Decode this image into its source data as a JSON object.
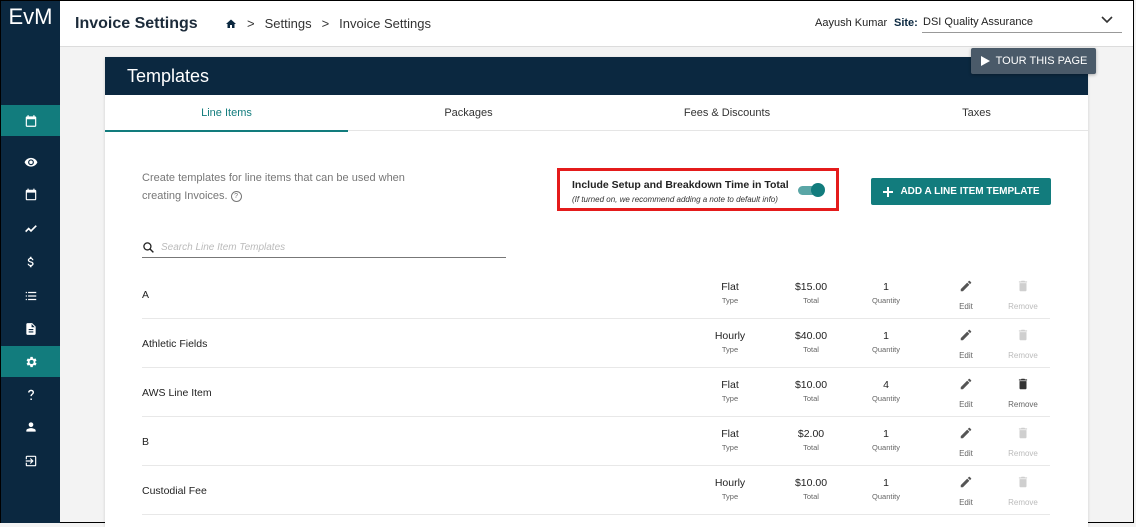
{
  "app": {
    "logo": "EvM"
  },
  "header": {
    "page_title": "Invoice Settings",
    "breadcrumb": [
      "Settings",
      "Invoice Settings"
    ],
    "breadcrumb_sep": ">",
    "user_name": "Aayush Kumar",
    "site_label": "Site:",
    "site_value": "DSI Quality Assurance"
  },
  "sidebar": {
    "items": [
      {
        "icon": "calendar-today-icon",
        "active": true
      },
      {
        "icon": "eye-icon",
        "active": false
      },
      {
        "icon": "calendar-icon",
        "active": false
      },
      {
        "icon": "trending-icon",
        "active": false
      },
      {
        "icon": "dollar-icon",
        "active": false
      },
      {
        "icon": "list-icon",
        "active": false
      },
      {
        "icon": "document-icon",
        "active": false
      },
      {
        "icon": "gear-icon",
        "active": true
      },
      {
        "icon": "help-icon",
        "active": false
      },
      {
        "icon": "user-icon",
        "active": false
      },
      {
        "icon": "logout-icon",
        "active": false
      }
    ]
  },
  "tour_button": "TOUR THIS PAGE",
  "card": {
    "title": "Templates",
    "tabs": [
      "Line Items",
      "Packages",
      "Fees & Discounts",
      "Taxes"
    ],
    "active_tab": 0,
    "description": "Create templates for line items that can be used when creating Invoices.",
    "toggle": {
      "title": "Include Setup and Breakdown Time in Total",
      "subtitle": "(If turned on, we recommend adding a note to default info)",
      "on": true
    },
    "add_button": "ADD A LINE ITEM TEMPLATE",
    "search_placeholder": "Search Line Item Templates",
    "columns": {
      "type": "Type",
      "total": "Total",
      "quantity": "Quantity",
      "edit": "Edit",
      "remove": "Remove"
    },
    "rows": [
      {
        "name": "A",
        "type": "Flat",
        "total": "$15.00",
        "quantity": "1",
        "removable": false
      },
      {
        "name": "Athletic Fields",
        "type": "Hourly",
        "total": "$40.00",
        "quantity": "1",
        "removable": false
      },
      {
        "name": "AWS Line Item",
        "type": "Flat",
        "total": "$10.00",
        "quantity": "4",
        "removable": true
      },
      {
        "name": "B",
        "type": "Flat",
        "total": "$2.00",
        "quantity": "1",
        "removable": false
      },
      {
        "name": "Custodial Fee",
        "type": "Hourly",
        "total": "$10.00",
        "quantity": "1",
        "removable": false
      }
    ]
  },
  "colors": {
    "navy": "#0b2840",
    "teal": "#127c7d",
    "highlight": "#e41b1b"
  }
}
